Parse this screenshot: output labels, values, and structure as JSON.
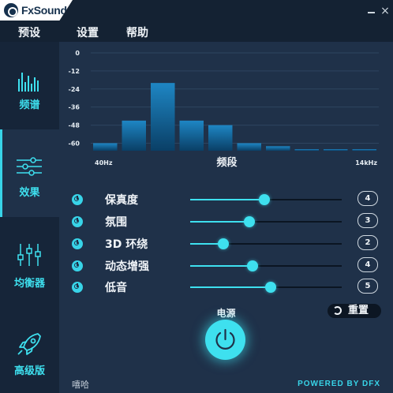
{
  "app": {
    "name": "FxSound"
  },
  "window": {
    "minimize_glyph": "—",
    "close_glyph": "×"
  },
  "menu": [
    {
      "label": "预设"
    },
    {
      "label": "设置"
    },
    {
      "label": "帮助"
    }
  ],
  "sidebar": {
    "items": [
      {
        "label": "频谱",
        "icon": "spectrum-icon",
        "active": false
      },
      {
        "label": "效果",
        "icon": "sliders-icon",
        "active": true
      },
      {
        "label": "均衡器",
        "icon": "equalizer-icon",
        "active": false
      },
      {
        "label": "高级版",
        "icon": "rocket-icon",
        "active": false
      }
    ]
  },
  "spectrum": {
    "title": "频段",
    "x_start_label": "40Hz",
    "x_end_label": "14kHz",
    "y_ticks": [
      "0",
      "-12",
      "-24",
      "-36",
      "-48",
      "-60"
    ],
    "colors": {
      "bar_top": "#1e86c4",
      "bar_bottom": "#0a3f66"
    }
  },
  "chart_data": {
    "type": "bar",
    "title": "",
    "xlabel": "频段",
    "ylabel": "",
    "ylim": [
      -65,
      0
    ],
    "x_range_labels": [
      "40Hz",
      "14kHz"
    ],
    "values": [
      -60,
      -45,
      -20,
      -45,
      -48,
      -60,
      -62,
      -64,
      -64,
      -66
    ]
  },
  "effects": [
    {
      "label": "保真度",
      "value": "4",
      "level": 0.49
    },
    {
      "label": "氛围",
      "value": "3",
      "level": 0.39
    },
    {
      "label": "3D 环绕",
      "value": "2",
      "level": 0.22
    },
    {
      "label": "动态增强",
      "value": "4",
      "level": 0.41
    },
    {
      "label": "低音",
      "value": "5",
      "level": 0.53
    }
  ],
  "reset": {
    "label": "重置"
  },
  "power": {
    "label": "电源",
    "on": true
  },
  "footer": {
    "left_text": "嘻哈",
    "right_text": "POWERED BY DFX"
  },
  "colors": {
    "accent": "#3ee0ef",
    "background": "#1f3149",
    "sidebar": "#162539",
    "titlebar": "#142233"
  }
}
